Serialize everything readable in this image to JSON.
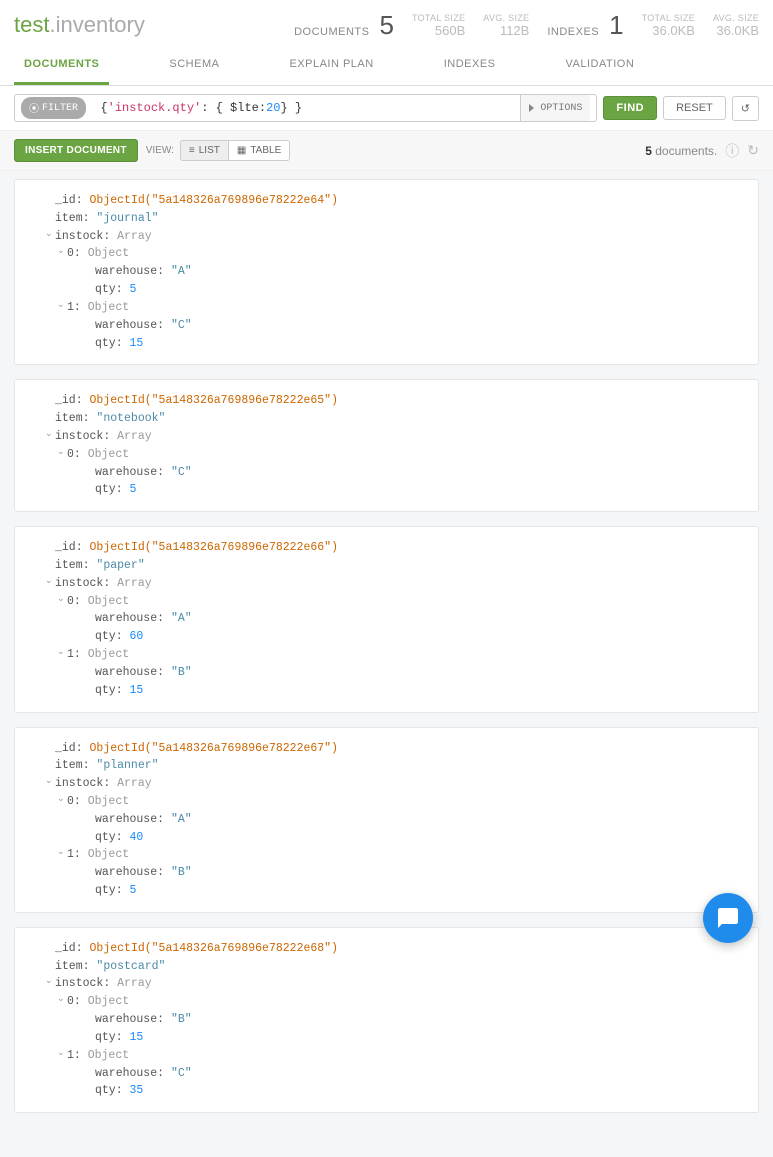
{
  "title": {
    "db": "test",
    "sep": ".",
    "coll": "inventory"
  },
  "stats": {
    "documents": {
      "label": "DOCUMENTS",
      "count": "5",
      "total_size_label": "TOTAL SIZE",
      "total_size": "560B",
      "avg_size_label": "AVG. SIZE",
      "avg_size": "112B"
    },
    "indexes": {
      "label": "INDEXES",
      "count": "1",
      "total_size_label": "TOTAL SIZE",
      "total_size": "36.0KB",
      "avg_size_label": "AVG. SIZE",
      "avg_size": "36.0KB"
    }
  },
  "tabs": [
    "DOCUMENTS",
    "SCHEMA",
    "EXPLAIN PLAN",
    "INDEXES",
    "VALIDATION"
  ],
  "filter": {
    "chip": "FILTER",
    "open": "{ ",
    "key": "'instock.qty'",
    "mid": ": { $lte: ",
    "num": "20",
    "close": " } }",
    "options": "OPTIONS",
    "find": "FIND",
    "reset": "RESET"
  },
  "toolbar": {
    "insert": "INSERT DOCUMENT",
    "view": "VIEW:",
    "list": "LIST",
    "table": "TABLE",
    "count_num": "5",
    "count_text": " documents."
  },
  "docs": [
    {
      "_id": "ObjectId(\"5a148326a769896e78222e64\")",
      "item": "\"journal\"",
      "instock": [
        {
          "warehouse": "\"A\"",
          "qty": "5"
        },
        {
          "warehouse": "\"C\"",
          "qty": "15"
        }
      ]
    },
    {
      "_id": "ObjectId(\"5a148326a769896e78222e65\")",
      "item": "\"notebook\"",
      "instock": [
        {
          "warehouse": "\"C\"",
          "qty": "5"
        }
      ]
    },
    {
      "_id": "ObjectId(\"5a148326a769896e78222e66\")",
      "item": "\"paper\"",
      "instock": [
        {
          "warehouse": "\"A\"",
          "qty": "60"
        },
        {
          "warehouse": "\"B\"",
          "qty": "15"
        }
      ]
    },
    {
      "_id": "ObjectId(\"5a148326a769896e78222e67\")",
      "item": "\"planner\"",
      "instock": [
        {
          "warehouse": "\"A\"",
          "qty": "40"
        },
        {
          "warehouse": "\"B\"",
          "qty": "5"
        }
      ]
    },
    {
      "_id": "ObjectId(\"5a148326a769896e78222e68\")",
      "item": "\"postcard\"",
      "instock": [
        {
          "warehouse": "\"B\"",
          "qty": "15"
        },
        {
          "warehouse": "\"C\"",
          "qty": "35"
        }
      ]
    }
  ],
  "field_labels": {
    "id": "_id",
    "item": "item",
    "instock": "instock",
    "array": "Array",
    "object": "Object",
    "warehouse": "warehouse",
    "qty": "qty"
  }
}
